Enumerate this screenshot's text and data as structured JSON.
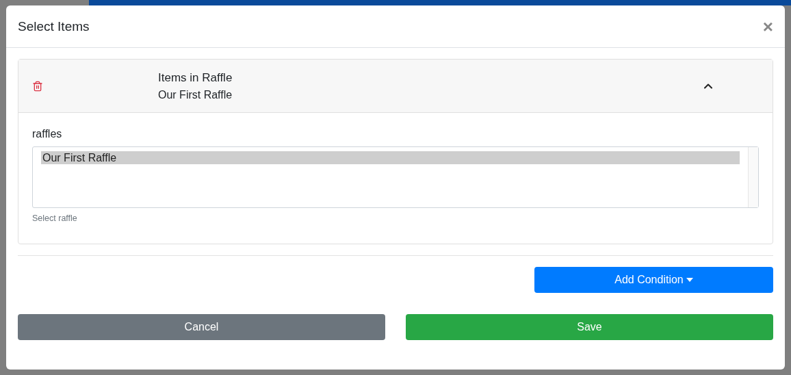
{
  "modal": {
    "title": "Select Items",
    "close": "×"
  },
  "conditions": [
    {
      "title": "Items in Raffle",
      "subtitle": "Our First Raffle",
      "expanded": true,
      "field": {
        "label": "raffles",
        "options": [
          {
            "label": "Our First Raffle",
            "selected": true
          }
        ],
        "help": "Select raffle"
      }
    }
  ],
  "add_button": {
    "label": "Add Condition"
  },
  "footer": {
    "cancel": "Cancel",
    "save": "Save"
  }
}
